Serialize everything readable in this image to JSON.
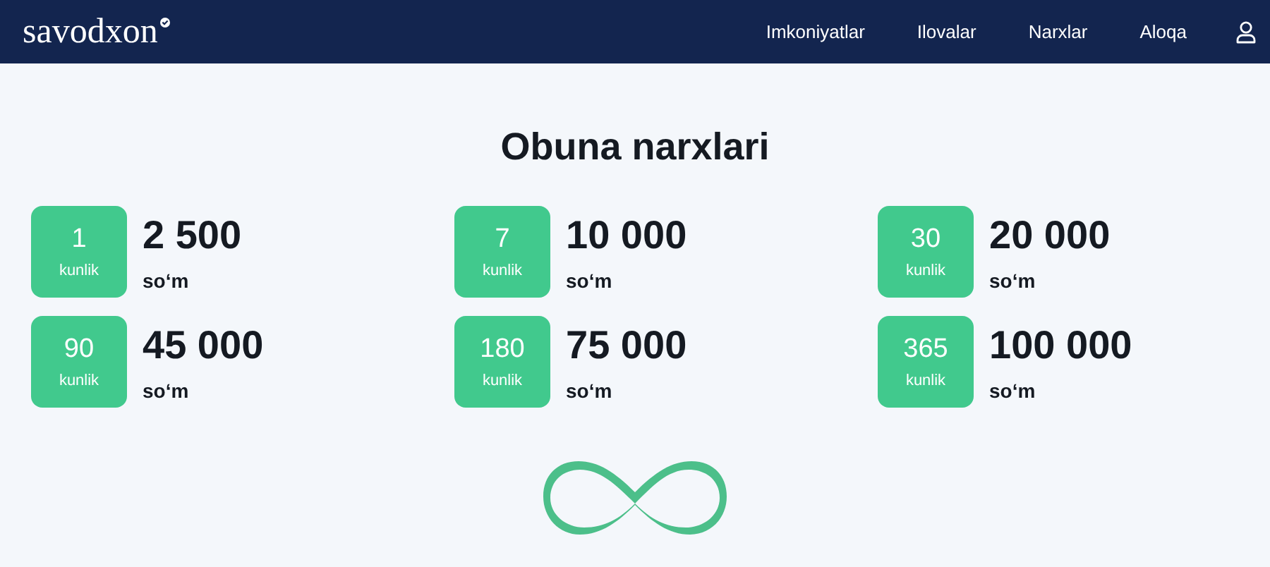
{
  "header": {
    "logo": "savodxon",
    "nav": [
      "Imkoniyatlar",
      "Ilovalar",
      "Narxlar",
      "Aloqa"
    ]
  },
  "title": "Obuna narxlari",
  "plans": [
    {
      "days": "1",
      "unit": "kunlik",
      "price": "2 500",
      "currency": "so‘m"
    },
    {
      "days": "7",
      "unit": "kunlik",
      "price": "10 000",
      "currency": "so‘m"
    },
    {
      "days": "30",
      "unit": "kunlik",
      "price": "20 000",
      "currency": "so‘m"
    },
    {
      "days": "90",
      "unit": "kunlik",
      "price": "45 000",
      "currency": "so‘m"
    },
    {
      "days": "180",
      "unit": "kunlik",
      "price": "75 000",
      "currency": "so‘m"
    },
    {
      "days": "365",
      "unit": "kunlik",
      "price": "100 000",
      "currency": "so‘m"
    }
  ]
}
